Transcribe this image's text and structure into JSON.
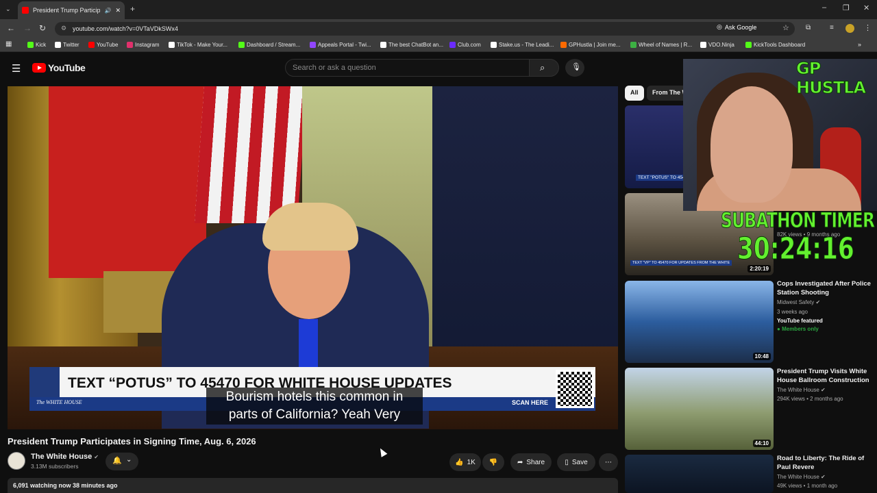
{
  "browser": {
    "tab_title": "President Trump Participate",
    "url": "youtube.com/watch?v=0VTaVDkSWx4",
    "ask_google": "Ask Google",
    "bookmarks": [
      {
        "label": "Kick",
        "color": "#53fc18"
      },
      {
        "label": "Twitter",
        "color": "#ffffff"
      },
      {
        "label": "YouTube",
        "color": "#ff0000"
      },
      {
        "label": "Instagram",
        "color": "#e1306c"
      },
      {
        "label": "TikTok - Make Your...",
        "color": "#ffffff"
      },
      {
        "label": "Dashboard / Stream...",
        "color": "#53fc18"
      },
      {
        "label": "Appeals Portal - Twi...",
        "color": "#9146ff"
      },
      {
        "label": "The best ChatBot an...",
        "color": "#ffffff"
      },
      {
        "label": "Club.com",
        "color": "#6b2bff"
      },
      {
        "label": "Stake.us - The Leadi...",
        "color": "#ffffff"
      },
      {
        "label": "GPHustla | Join me...",
        "color": "#ff6a00"
      },
      {
        "label": "Wheel of Names | R...",
        "color": "#3cb043"
      },
      {
        "label": "VDO.Ninja",
        "color": "#ffffff"
      },
      {
        "label": "KickTools Dashboard",
        "color": "#53fc18"
      }
    ]
  },
  "youtube": {
    "logo": "YouTube",
    "search_placeholder": "Search or ask a question"
  },
  "video": {
    "banner_text": "TEXT “POTUS” TO 45470 FOR WHITE HOUSE UPDATES",
    "banner_brand": "The WHITE HOUSE",
    "banner_scan": "SCAN HERE",
    "caption_line1": "Bourism hotels this common in",
    "caption_line2": "parts of California? Yeah Very",
    "title": "President Trump Participates in Signing Time, Aug. 6, 2026",
    "channel": "The White House",
    "subscribers": "3.13M subscribers",
    "likes": "1K",
    "share": "Share",
    "save": "Save",
    "meta": "6,091 watching now  38 minutes ago"
  },
  "sidebar": {
    "chips": [
      "All",
      "From The W"
    ],
    "items": [
      {
        "duration": "",
        "thumb_text": "TEXT \"POTUS\" TO 454",
        "title": "",
        "channel": "",
        "stats": "",
        "extra": ""
      },
      {
        "duration": "2:20:19",
        "thumb_text": "TEXT \"VP\" TO 45470 FOR UPDATES FROM THE WHITE",
        "title": "",
        "channel": "",
        "stats": "82K views • 9 months ago",
        "extra": ""
      },
      {
        "duration": "10:48",
        "thumb_text": "",
        "title": "Cops Investigated After Police Station Shooting",
        "channel": "Midwest Safety",
        "stats": "3 weeks ago",
        "extra": "YouTube featured",
        "badge": "Members only"
      },
      {
        "duration": "44:10",
        "thumb_text": "",
        "title": "President Trump Visits White House Ballroom Construction",
        "channel": "The White House",
        "stats": "294K views • 2 months ago",
        "extra": ""
      },
      {
        "duration": "",
        "thumb_text": "",
        "title": "Road to Liberty: The Ride of Paul Revere",
        "channel": "The White House",
        "stats": "49K views • 1 month ago",
        "extra": ""
      }
    ]
  },
  "overlay": {
    "streamer_name": "GP HUSTLA",
    "subathon_label": "SUBATHON TIMER",
    "subathon_timer": "30:24:16"
  }
}
